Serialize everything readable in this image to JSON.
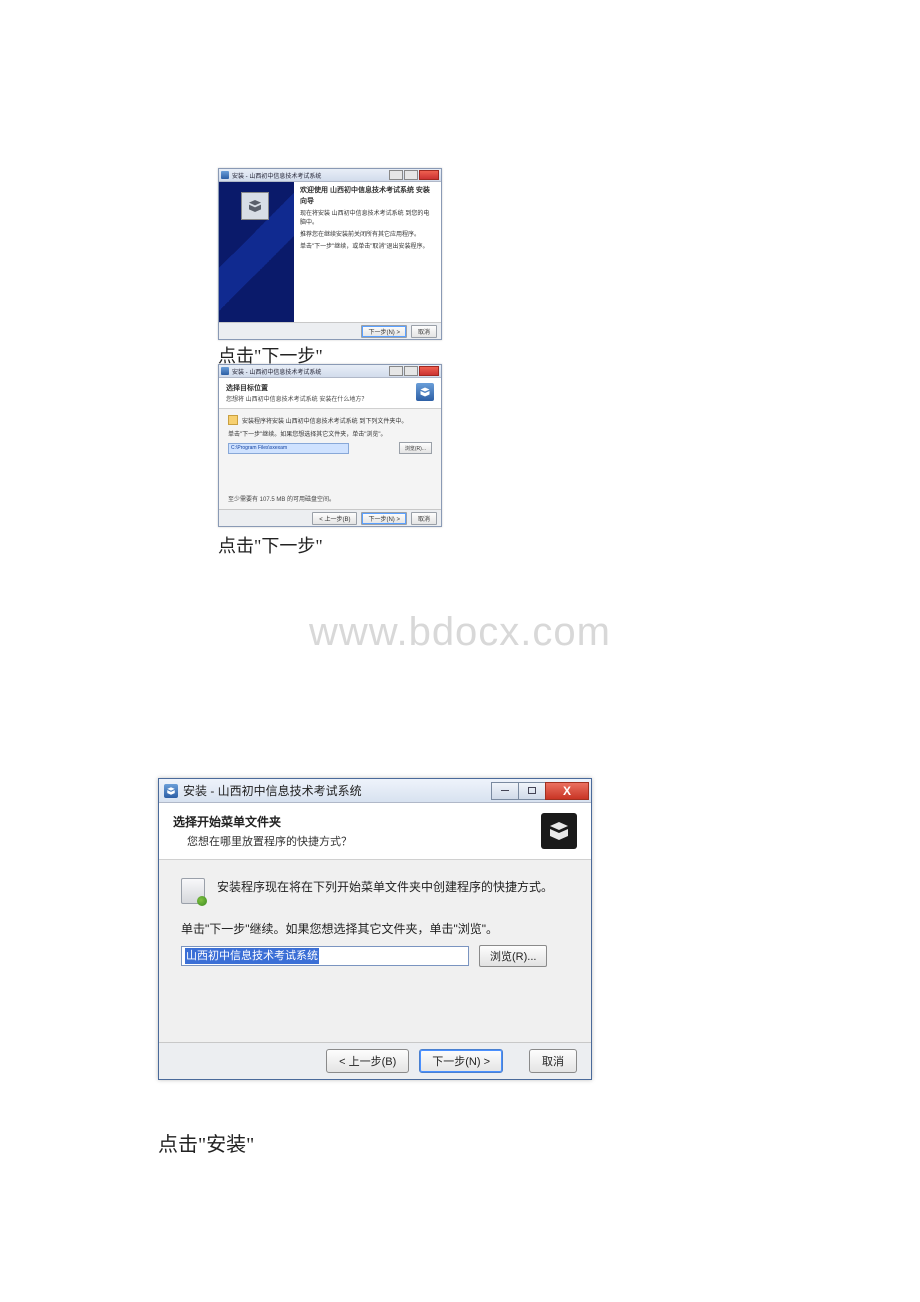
{
  "win1": {
    "title": "安装 - 山西初中信息技术考试系统",
    "heading": "欢迎使用 山西初中信息技术考试系统 安装向导",
    "line1": "现在将安装 山西初中信息技术考试系统 到您的电脑中。",
    "line2": "推荐您在继续安装前关闭所有其它应用程序。",
    "line3": "单击\"下一步\"继续，或单击\"取消\"退出安装程序。",
    "next": "下一步(N) >",
    "cancel": "取消"
  },
  "caption1": "点击\"下一步\"",
  "win2": {
    "title": "安装 - 山西初中信息技术考试系统",
    "head1": "选择目标位置",
    "head2": "您想将 山西初中信息技术考试系统 安装在什么地方？",
    "instr": "安装程序将安装 山西初中信息技术考试系统 到下列文件夹中。",
    "sub": "单击\"下一步\"继续。如果您想选择其它文件夹，单击\"浏览\"。",
    "path": "C:\\Program Files\\sxexam",
    "browse": "浏览(R)...",
    "space": "至少需要有 107.5 MB 的可用磁盘空间。",
    "back": "< 上一步(B)",
    "next": "下一步(N) >",
    "cancel": "取消"
  },
  "caption2": "点击\"下一步\"",
  "watermark": "www.bdocx.com",
  "win3": {
    "title": "安装 - 山西初中信息技术考试系统",
    "head1": "选择开始菜单文件夹",
    "head2": "您想在哪里放置程序的快捷方式？",
    "instr": "安装程序现在将在下列开始菜单文件夹中创建程序的快捷方式。",
    "sub": "单击\"下一步\"继续。如果您想选择其它文件夹，单击\"浏览\"。",
    "path": "山西初中信息技术考试系统",
    "browse": "浏览(R)...",
    "back": "< 上一步(B)",
    "next": "下一步(N) >",
    "cancel": "取消",
    "close": "X"
  },
  "caption3": "点击\"安装\""
}
